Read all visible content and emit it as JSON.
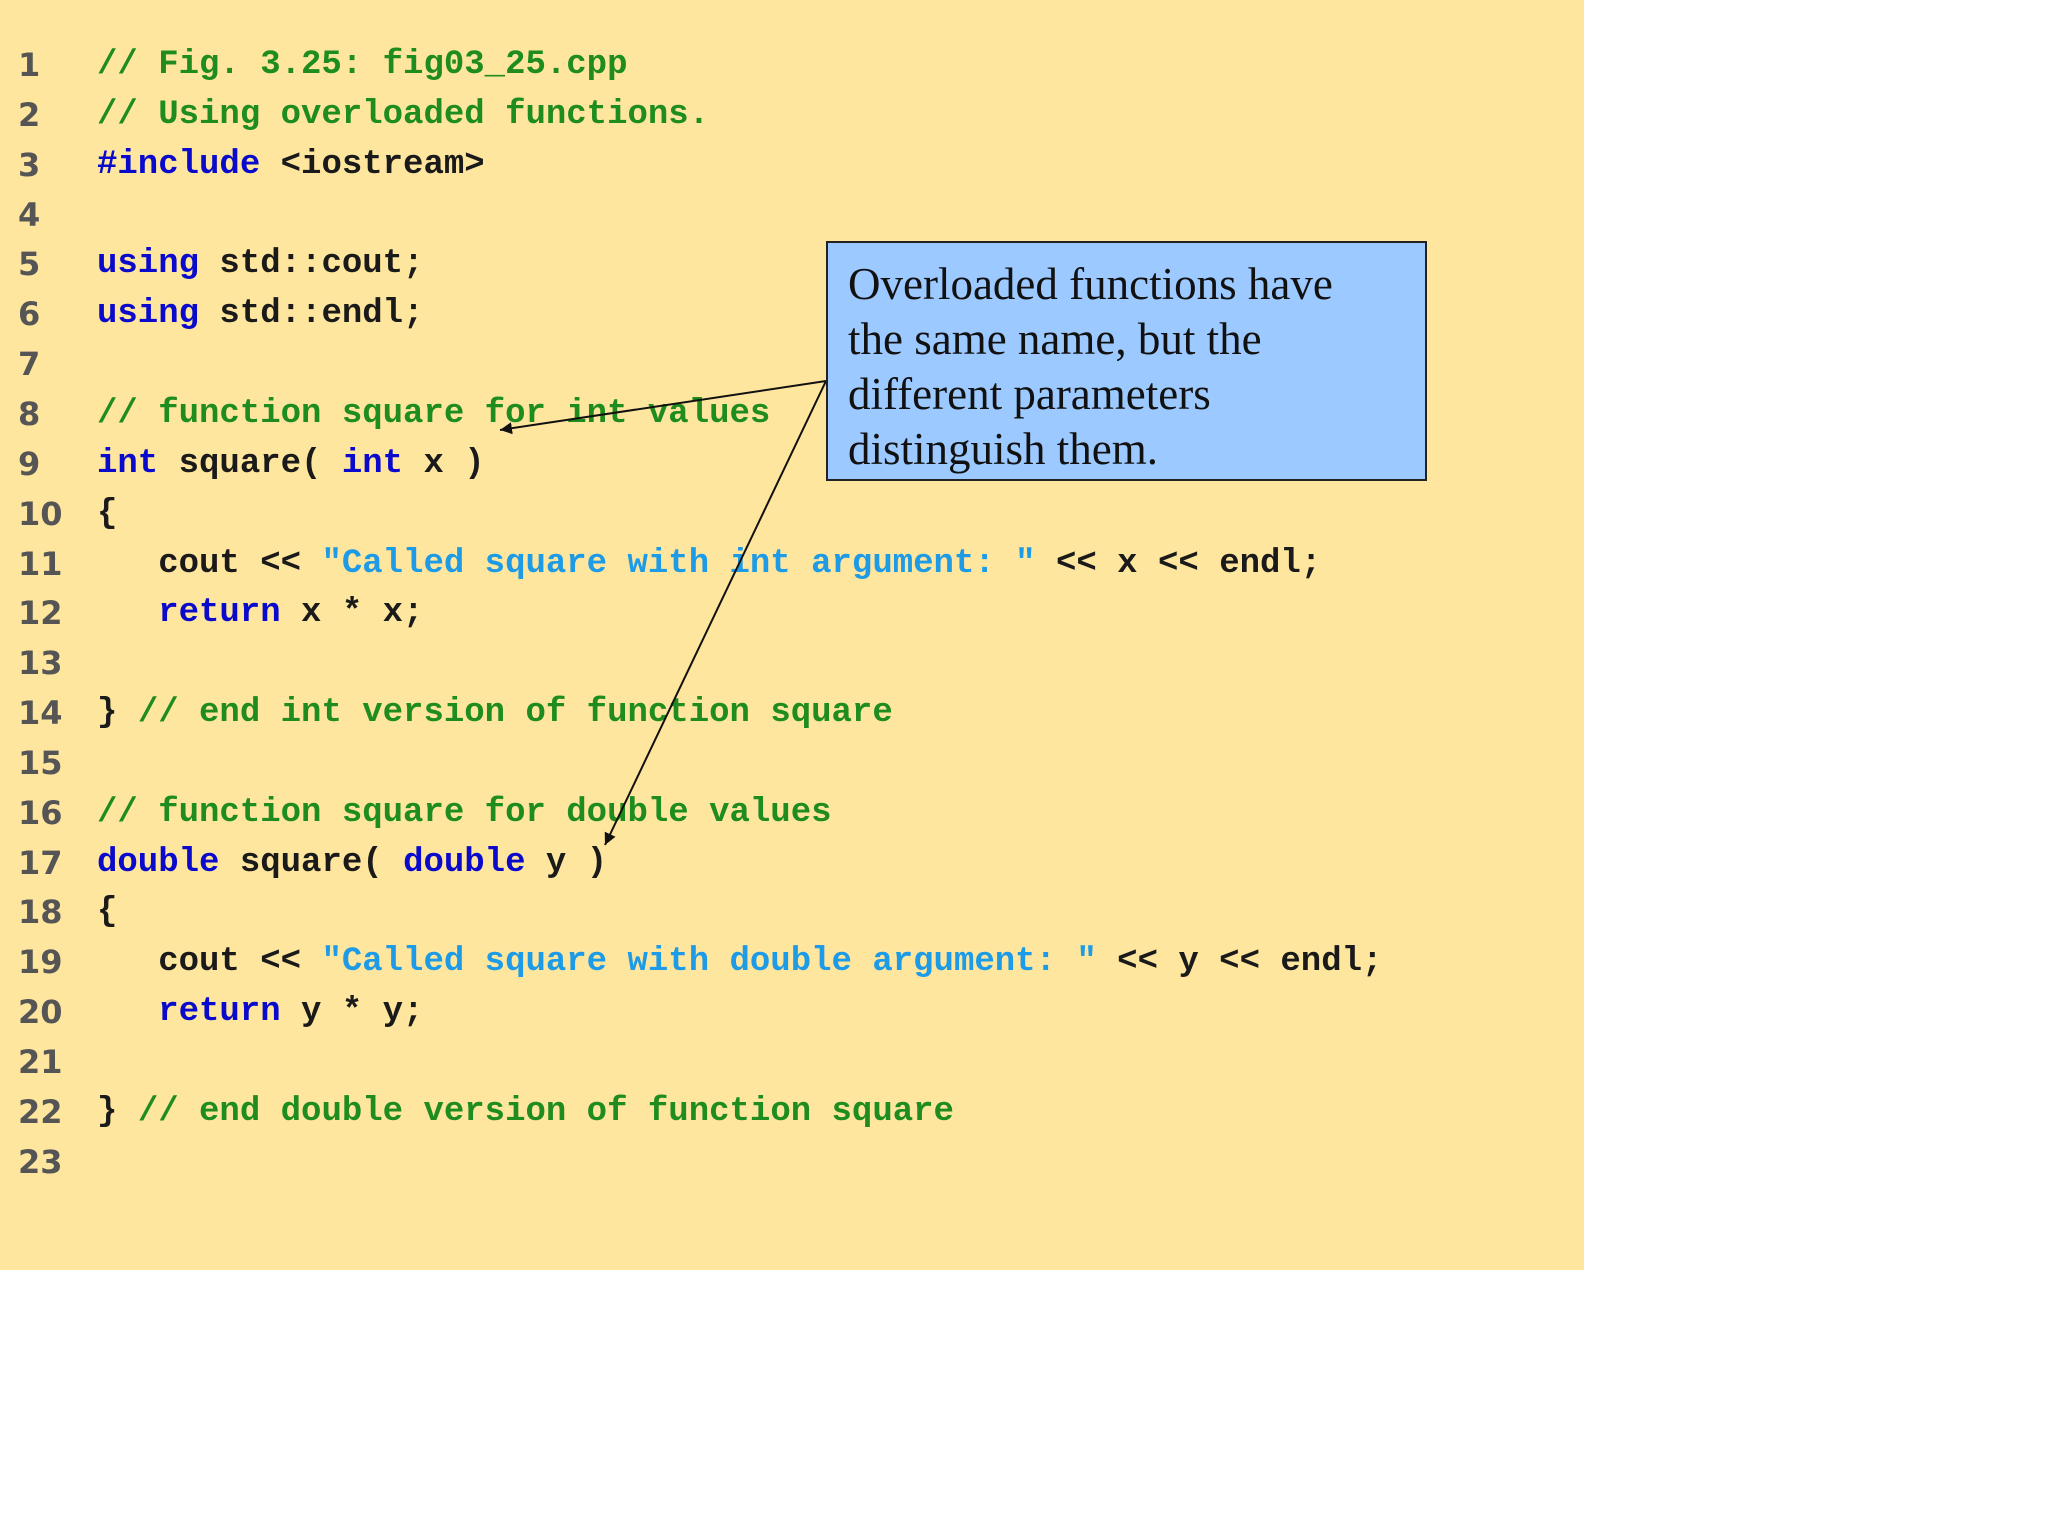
{
  "colors": {
    "background": "#FFE69E",
    "comment": "#1E8C1E",
    "keyword": "#0A0ACC",
    "string": "#1E9BE6",
    "plain": "#1A1A1A",
    "line_number": "#555555",
    "callout_fill": "#9CC9FF"
  },
  "code_lines": [
    {
      "n": "1",
      "tokens": [
        {
          "t": "// Fig. 3.25: fig03_25.cpp",
          "k": "comment"
        }
      ]
    },
    {
      "n": "2",
      "tokens": [
        {
          "t": "// Using overloaded functions.",
          "k": "comment"
        }
      ]
    },
    {
      "n": "3",
      "tokens": [
        {
          "t": "#include",
          "k": "keyword"
        },
        {
          "t": " <iostream>",
          "k": "plain"
        }
      ]
    },
    {
      "n": "4",
      "tokens": []
    },
    {
      "n": "5",
      "tokens": [
        {
          "t": "using",
          "k": "keyword"
        },
        {
          "t": " std::cout;",
          "k": "plain"
        }
      ]
    },
    {
      "n": "6",
      "tokens": [
        {
          "t": "using",
          "k": "keyword"
        },
        {
          "t": " std::endl;",
          "k": "plain"
        }
      ]
    },
    {
      "n": "7",
      "tokens": []
    },
    {
      "n": "8",
      "tokens": [
        {
          "t": "// function square for int values",
          "k": "comment"
        }
      ]
    },
    {
      "n": "9",
      "tokens": [
        {
          "t": "int",
          "k": "keyword"
        },
        {
          "t": " square( ",
          "k": "plain"
        },
        {
          "t": "int",
          "k": "keyword"
        },
        {
          "t": " x )",
          "k": "plain"
        }
      ]
    },
    {
      "n": "10",
      "tokens": [
        {
          "t": "{",
          "k": "plain"
        }
      ]
    },
    {
      "n": "11",
      "tokens": [
        {
          "t": "   cout << ",
          "k": "plain"
        },
        {
          "t": "\"Called square with int argument: \"",
          "k": "string"
        },
        {
          "t": " << x << endl;",
          "k": "plain"
        }
      ]
    },
    {
      "n": "12",
      "tokens": [
        {
          "t": "   ",
          "k": "plain"
        },
        {
          "t": "return",
          "k": "keyword"
        },
        {
          "t": " x * x;",
          "k": "plain"
        }
      ]
    },
    {
      "n": "13",
      "tokens": []
    },
    {
      "n": "14",
      "tokens": [
        {
          "t": "} ",
          "k": "plain"
        },
        {
          "t": "// end int version of function square",
          "k": "comment"
        }
      ]
    },
    {
      "n": "15",
      "tokens": []
    },
    {
      "n": "16",
      "tokens": [
        {
          "t": "// function square for double values",
          "k": "comment"
        }
      ]
    },
    {
      "n": "17",
      "tokens": [
        {
          "t": "double",
          "k": "keyword"
        },
        {
          "t": " square( ",
          "k": "plain"
        },
        {
          "t": "double",
          "k": "keyword"
        },
        {
          "t": " y )",
          "k": "plain"
        }
      ]
    },
    {
      "n": "18",
      "tokens": [
        {
          "t": "{",
          "k": "plain"
        }
      ]
    },
    {
      "n": "19",
      "tokens": [
        {
          "t": "   cout << ",
          "k": "plain"
        },
        {
          "t": "\"Called square with double argument: \"",
          "k": "string"
        },
        {
          "t": " << y << endl;",
          "k": "plain"
        }
      ]
    },
    {
      "n": "20",
      "tokens": [
        {
          "t": "   ",
          "k": "plain"
        },
        {
          "t": "return",
          "k": "keyword"
        },
        {
          "t": " y * y;",
          "k": "plain"
        }
      ]
    },
    {
      "n": "21",
      "tokens": []
    },
    {
      "n": "22",
      "tokens": [
        {
          "t": "} ",
          "k": "plain"
        },
        {
          "t": "// end double version of function square",
          "k": "comment"
        }
      ]
    },
    {
      "n": "23",
      "tokens": []
    }
  ],
  "callout": {
    "lines": [
      "Overloaded functions have",
      "the same name, but the",
      "different parameters",
      "distinguish them."
    ]
  }
}
